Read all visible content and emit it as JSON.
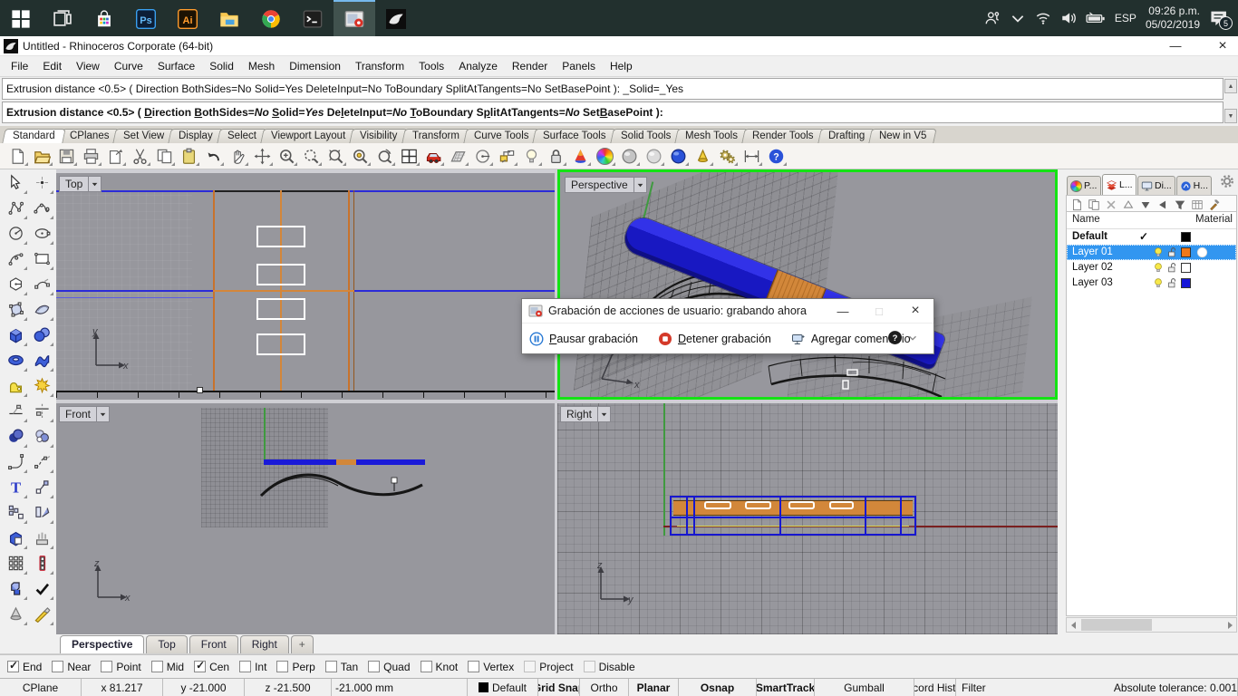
{
  "colors": {
    "c_taskbar": "#22302e",
    "c_green": "#14e314",
    "c_blue": "#1717cf",
    "c_orange": "#d2873a",
    "c_sel": "#3296f0"
  },
  "taskbar": {
    "items": [
      {
        "name": "taskbar-start-button",
        "icon": "win"
      },
      {
        "name": "taskbar-task-view",
        "icon": "task-view"
      },
      {
        "name": "taskbar-store",
        "icon": "store"
      },
      {
        "name": "taskbar-photoshop",
        "icon": "ps"
      },
      {
        "name": "taskbar-illustrator",
        "icon": "ai"
      },
      {
        "name": "taskbar-file-explorer",
        "icon": "folder"
      },
      {
        "name": "taskbar-chrome",
        "icon": "chrome"
      },
      {
        "name": "taskbar-command-prompt",
        "icon": "cmd"
      },
      {
        "name": "taskbar-screen-recorder",
        "icon": "recorder",
        "active": true
      },
      {
        "name": "taskbar-rhino",
        "icon": "rhino"
      }
    ],
    "tray": {
      "language": "ESP",
      "time": "09:26 p.m.",
      "date": "05/02/2019",
      "notifications": "5"
    }
  },
  "app": {
    "title": "Untitled - Rhinoceros Corporate (64-bit)",
    "minimize": "—",
    "close": "×"
  },
  "menubar": {
    "items": [
      "File",
      "Edit",
      "View",
      "Curve",
      "Surface",
      "Solid",
      "Mesh",
      "Dimension",
      "Transform",
      "Tools",
      "Analyze",
      "Render",
      "Panels",
      "Help"
    ]
  },
  "command": {
    "history": "Extrusion distance <0.5> ( Direction BothSides=No Solid=Yes DeleteInput=No ToBoundary SplitAtTangents=No SetBasePoint ): _Solid=_Yes",
    "prompt_segments": [
      {
        "t": "Extrusion distance <0.5> ( "
      },
      {
        "t": "D",
        "u": true
      },
      {
        "t": "irection "
      },
      {
        "t": "B",
        "u": true
      },
      {
        "t": "othSides="
      },
      {
        "t": "No",
        "i": true
      },
      {
        "t": " "
      },
      {
        "t": "S",
        "u": true
      },
      {
        "t": "olid="
      },
      {
        "t": "Yes",
        "i": true
      },
      {
        "t": " "
      },
      {
        "t": "De"
      },
      {
        "t": "l",
        "u": true
      },
      {
        "t": "eteInput="
      },
      {
        "t": "No",
        "i": true
      },
      {
        "t": " "
      },
      {
        "t": "T",
        "u": true
      },
      {
        "t": "oBoundary "
      },
      {
        "t": "S"
      },
      {
        "t": "p",
        "u": true
      },
      {
        "t": "litAtTangents="
      },
      {
        "t": "No",
        "i": true
      },
      {
        "t": " "
      },
      {
        "t": "Set"
      },
      {
        "t": "B",
        "u": true
      },
      {
        "t": "asePoint ):"
      }
    ]
  },
  "ribbon_tabs": {
    "items": [
      {
        "label": "Standard",
        "active": true
      },
      {
        "label": "CPlanes"
      },
      {
        "label": "Set View"
      },
      {
        "label": "Display"
      },
      {
        "label": "Select"
      },
      {
        "label": "Viewport Layout"
      },
      {
        "label": "Visibility"
      },
      {
        "label": "Transform"
      },
      {
        "label": "Curve Tools"
      },
      {
        "label": "Surface Tools"
      },
      {
        "label": "Solid Tools"
      },
      {
        "label": "Mesh Tools"
      },
      {
        "label": "Render Tools"
      },
      {
        "label": "Drafting"
      },
      {
        "label": "New in V5"
      }
    ]
  },
  "toolbar": {
    "icons": [
      {
        "name": "toolbar-new-file",
        "icon": "new-file"
      },
      {
        "name": "toolbar-open-file",
        "icon": "open-file"
      },
      {
        "name": "toolbar-save-file",
        "icon": "save-file"
      },
      {
        "name": "toolbar-print",
        "icon": "print"
      },
      {
        "name": "toolbar-export-doc",
        "icon": "export-doc"
      },
      {
        "name": "toolbar-cut",
        "icon": "cut"
      },
      {
        "name": "toolbar-copy",
        "icon": "copy"
      },
      {
        "name": "toolbar-paste",
        "icon": "paste"
      },
      {
        "name": "toolbar-undo",
        "icon": "undo"
      },
      {
        "name": "toolbar-pan",
        "icon": "pan"
      },
      {
        "name": "toolbar-move",
        "icon": "move"
      },
      {
        "name": "toolbar-zoom-in",
        "icon": "zoom-in"
      },
      {
        "name": "toolbar-zoom-window",
        "icon": "zoom-window"
      },
      {
        "name": "toolbar-zoom-extents",
        "icon": "zoom-extents"
      },
      {
        "name": "toolbar-zoom-selected",
        "icon": "zoom-selected"
      },
      {
        "name": "toolbar-rotate-view",
        "icon": "rotate-view"
      },
      {
        "name": "toolbar-viewport-layout",
        "icon": "vp-layout"
      },
      {
        "name": "toolbar-display-mode",
        "icon": "car"
      },
      {
        "name": "toolbar-cplane",
        "icon": "cplane"
      },
      {
        "name": "toolbar-set-view",
        "icon": "set-view"
      },
      {
        "name": "toolbar-named-view",
        "icon": "named-view"
      },
      {
        "name": "toolbar-visibility",
        "icon": "bulb-tool"
      },
      {
        "name": "toolbar-lock",
        "icon": "lock"
      },
      {
        "name": "toolbar-render",
        "icon": "render-cone"
      },
      {
        "name": "toolbar-render-settings",
        "icon": "color-wheel"
      },
      {
        "name": "toolbar-shaded-viewport",
        "icon": "sphere-gray"
      },
      {
        "name": "toolbar-ghosted-viewport",
        "icon": "sphere-ghost"
      },
      {
        "name": "toolbar-rendered-viewport",
        "icon": "sphere-blue"
      },
      {
        "name": "toolbar-whats-new",
        "icon": "cone-yellow"
      },
      {
        "name": "toolbar-options",
        "icon": "gears"
      },
      {
        "name": "toolbar-dimension",
        "icon": "dimension"
      },
      {
        "name": "toolbar-help",
        "icon": "help-blue"
      }
    ]
  },
  "sidebar": {
    "tools": [
      {
        "name": "tool-select",
        "icon": "select-arrow"
      },
      {
        "name": "tool-point",
        "icon": "point"
      },
      {
        "name": "tool-polyline",
        "icon": "polyline"
      },
      {
        "name": "tool-curve",
        "icon": "curve"
      },
      {
        "name": "tool-circle",
        "icon": "circle"
      },
      {
        "name": "tool-ellipse",
        "icon": "ellipse"
      },
      {
        "name": "tool-arc",
        "icon": "arc"
      },
      {
        "name": "tool-rectangle",
        "icon": "rectangle"
      },
      {
        "name": "tool-polygon",
        "icon": "polygon"
      },
      {
        "name": "tool-curve-edit",
        "icon": "curve-handles"
      },
      {
        "name": "tool-control-cage",
        "icon": "cage"
      },
      {
        "name": "tool-surface-corner",
        "icon": "patch-srf"
      },
      {
        "name": "tool-box",
        "icon": "box"
      },
      {
        "name": "tool-sphere",
        "icon": "spheres"
      },
      {
        "name": "tool-torus",
        "icon": "torus"
      },
      {
        "name": "tool-loft",
        "icon": "loft"
      },
      {
        "name": "tool-join",
        "icon": "puzzle"
      },
      {
        "name": "tool-explode",
        "icon": "burst"
      },
      {
        "name": "tool-trim",
        "icon": "trim"
      },
      {
        "name": "tool-split",
        "icon": "split"
      },
      {
        "name": "tool-boolean-union",
        "icon": "bool-dark"
      },
      {
        "name": "tool-boolean-intersect",
        "icon": "bool-light"
      },
      {
        "name": "tool-fillet",
        "icon": "fillet"
      },
      {
        "name": "tool-blend",
        "icon": "blend"
      },
      {
        "name": "tool-text",
        "icon": "text-t"
      },
      {
        "name": "tool-move-point",
        "icon": "move-pt"
      },
      {
        "name": "tool-copy",
        "icon": "copy-arr"
      },
      {
        "name": "tool-orient",
        "icon": "plane-rot"
      },
      {
        "name": "tool-boolean-difference",
        "icon": "bool-diff"
      },
      {
        "name": "tool-extrude",
        "icon": "extrude"
      },
      {
        "name": "tool-array",
        "icon": "grid9"
      },
      {
        "name": "tool-array-linear",
        "icon": "arr-lin"
      },
      {
        "name": "tool-group",
        "icon": "solids"
      },
      {
        "name": "tool-check",
        "icon": "check"
      },
      {
        "name": "tool-cone",
        "icon": "cone-gray2"
      },
      {
        "name": "tool-cutter",
        "icon": "knife"
      }
    ]
  },
  "viewports": {
    "top": {
      "label": "Top",
      "axis_v": "y",
      "axis_h": "x"
    },
    "perspective": {
      "label": "Perspective",
      "axis_v": "y",
      "axis_h": "x"
    },
    "front": {
      "label": "Front",
      "axis_v": "z",
      "axis_h": "x"
    },
    "right": {
      "label": "Right",
      "axis_v": "z",
      "axis_h": "y"
    }
  },
  "layers_panel": {
    "tabs": [
      {
        "name": "panel-tab-properties",
        "icon": "tab-wheel",
        "label": "P..."
      },
      {
        "name": "panel-tab-layers",
        "icon": "tab-layers",
        "label": "L...",
        "active": true
      },
      {
        "name": "panel-tab-display",
        "icon": "tab-display",
        "label": "Di..."
      },
      {
        "name": "panel-tab-help",
        "icon": "tab-help",
        "label": "H..."
      }
    ],
    "toolbar": [
      {
        "name": "layer-new",
        "icon": "l-new"
      },
      {
        "name": "layer-new-sublayer",
        "icon": "l-sub"
      },
      {
        "name": "layer-delete",
        "icon": "l-del"
      },
      {
        "name": "layer-move-up",
        "icon": "l-up"
      },
      {
        "name": "layer-move-down",
        "icon": "l-down"
      },
      {
        "name": "layer-move-left",
        "icon": "l-left"
      },
      {
        "name": "layer-filter",
        "icon": "l-filter"
      },
      {
        "name": "layer-columns",
        "icon": "l-columns"
      },
      {
        "name": "layer-tools",
        "icon": "l-hammer"
      }
    ],
    "columns": {
      "name": "Name",
      "material": "Material"
    },
    "rows": [
      {
        "name": "Default",
        "bold": true,
        "current": true,
        "color": "#000000"
      },
      {
        "name": "Layer 01",
        "selected": true,
        "visible": true,
        "unlocked": true,
        "color": "#f07818",
        "material": true
      },
      {
        "name": "Layer 02",
        "visible": true,
        "unlocked": true,
        "color": "#ffffff"
      },
      {
        "name": "Layer 03",
        "visible": true,
        "unlocked": true,
        "color": "#1515d8"
      }
    ]
  },
  "vp_tabs": {
    "items": [
      {
        "name": "viewport-tab-perspective",
        "label": "Perspective",
        "active": true
      },
      {
        "name": "viewport-tab-top",
        "label": "Top"
      },
      {
        "name": "viewport-tab-front",
        "label": "Front"
      },
      {
        "name": "viewport-tab-right",
        "label": "Right"
      },
      {
        "name": "viewport-tab-new",
        "label": "+",
        "plus": true
      }
    ]
  },
  "osnap": {
    "items": [
      {
        "label": "End",
        "checked": true
      },
      {
        "label": "Near"
      },
      {
        "label": "Point"
      },
      {
        "label": "Mid"
      },
      {
        "label": "Cen",
        "checked": true
      },
      {
        "label": "Int"
      },
      {
        "label": "Perp"
      },
      {
        "label": "Tan"
      },
      {
        "label": "Quad"
      },
      {
        "label": "Knot"
      },
      {
        "label": "Vertex"
      },
      {
        "label": "Project",
        "muted": true
      },
      {
        "label": "Disable",
        "muted": true
      }
    ]
  },
  "statusbar": {
    "cells": [
      {
        "label": "CPlane"
      },
      {
        "label": "x 81.217"
      },
      {
        "label": "y -21.000"
      },
      {
        "label": "z -21.500"
      },
      {
        "label": "-21.000 mm"
      },
      {
        "label": "Default",
        "swatch": true
      },
      {
        "label": "Grid Snap",
        "bold": true
      },
      {
        "label": "Ortho"
      },
      {
        "label": "Planar",
        "bold": true
      },
      {
        "label": "Osnap",
        "bold": true
      },
      {
        "label": "SmartTrack",
        "bold": true
      },
      {
        "label": "Gumball"
      },
      {
        "label": "Record History"
      },
      {
        "label": "Filter"
      },
      {
        "label": "Absolute tolerance: 0.001"
      }
    ]
  },
  "dialog": {
    "title": "Grabación de acciones de usuario: grabando ahora",
    "minimize": "—",
    "maximize": "□",
    "close": "×",
    "buttons": [
      {
        "name": "pause-recording-button",
        "icon": "pause-circle",
        "label_u": "P",
        "label_rest": "ausar grabación"
      },
      {
        "name": "stop-recording-button",
        "icon": "stop-circle",
        "label_u": "D",
        "label_rest": "etener grabación"
      },
      {
        "name": "add-comment-button",
        "icon": "comment-icon",
        "label_u": "",
        "label_rest": "Agregar comentario"
      }
    ]
  }
}
